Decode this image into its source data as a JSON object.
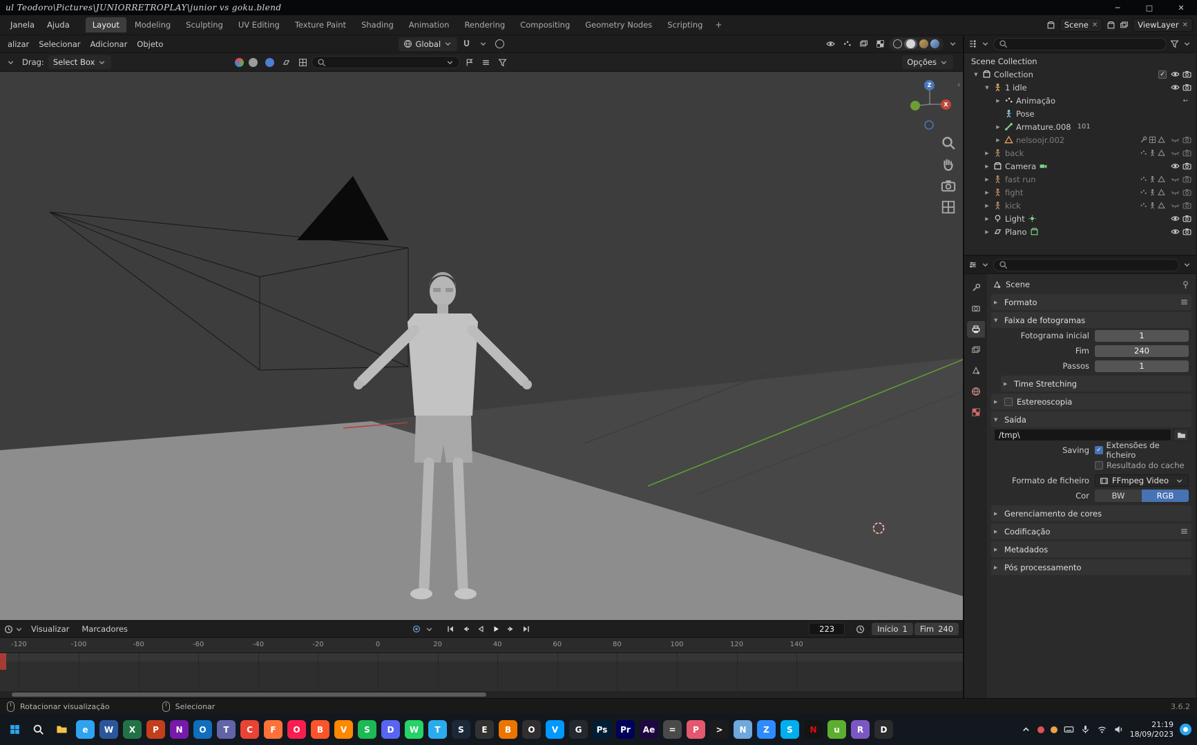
{
  "window": {
    "title": "ul Teodoro\\Pictures\\JUNIORRETROPLAY\\junior vs goku.blend",
    "minimize": "─",
    "maximize": "□",
    "close": "✕"
  },
  "colors": {
    "accent": "#4772b3",
    "axis_green": "#5f9e33",
    "axis_red": "#b34040",
    "viewport_bg": "#3d3d3d",
    "floor": "#8d8d8d"
  },
  "topbar": {
    "menus": [
      "Janela",
      "Ajuda"
    ],
    "workspaces": [
      "Layout",
      "Modeling",
      "Sculpting",
      "UV Editing",
      "Texture Paint",
      "Shading",
      "Animation",
      "Rendering",
      "Compositing",
      "Geometry Nodes",
      "Scripting"
    ],
    "active_workspace": "Layout",
    "add_tab": "+",
    "scene": "Scene",
    "viewlayer": "ViewLayer"
  },
  "viewport": {
    "menus": [
      "alizar",
      "Selecionar",
      "Adicionar",
      "Objeto"
    ],
    "orientation": "Global",
    "drag_label": "Drag:",
    "tool": "Select Box",
    "options": "Opções",
    "gizmo": {
      "z": "Z",
      "x": "X"
    }
  },
  "outliner": {
    "root": "Scene Collection",
    "items": [
      {
        "label": "Collection",
        "depth": 0,
        "arrow": "open",
        "icon": "box",
        "icon_color": "#d8d8d8",
        "checkbox": true,
        "eye": "open",
        "cam": "on"
      },
      {
        "label": "1 idle",
        "depth": 1,
        "arrow": "open",
        "icon": "stickman",
        "icon_color": "#e8a45c",
        "eye": "open",
        "cam": "on"
      },
      {
        "label": "Animação",
        "depth": 2,
        "arrow": "closed",
        "icon": "dots",
        "icon_color": "#d8d8d8",
        "minis": [
          "keys"
        ]
      },
      {
        "label": "Pose",
        "depth": 2,
        "arrow": "none",
        "icon": "stickman",
        "icon_color": "#8fc7e8"
      },
      {
        "label": "Armature.008",
        "depth": 2,
        "arrow": "closed",
        "icon": "bone",
        "icon_color": "#7fd08a",
        "badge": "101"
      },
      {
        "label": "nelsoojr.002",
        "depth": 2,
        "arrow": "closed",
        "icon": "tri",
        "icon_color": "#e8a45c",
        "grayed": true,
        "minis": [
          "wrench",
          "grid",
          "tri"
        ],
        "eye": "closed",
        "cam": "off"
      },
      {
        "label": "back",
        "depth": 1,
        "arrow": "closed",
        "icon": "stickman",
        "icon_color": "#b08a5f",
        "grayed": true,
        "minis": [
          "dots",
          "stickman",
          "tri"
        ],
        "eye": "closed",
        "cam": "off"
      },
      {
        "label": "Camera",
        "depth": 1,
        "arrow": "closed",
        "icon": "camobj",
        "icon_color": "#d8d8d8",
        "extra": "camdata",
        "eye": "open",
        "cam": "on"
      },
      {
        "label": "fast run",
        "depth": 1,
        "arrow": "closed",
        "icon": "stickman",
        "icon_color": "#b08a5f",
        "grayed": true,
        "minis": [
          "dots",
          "stickman",
          "tri"
        ],
        "eye": "closed",
        "cam": "off"
      },
      {
        "label": "fight",
        "depth": 1,
        "arrow": "closed",
        "icon": "stickman",
        "icon_color": "#b08a5f",
        "grayed": true,
        "minis": [
          "dots",
          "stickman",
          "tri"
        ],
        "eye": "closed",
        "cam": "off"
      },
      {
        "label": "kick",
        "depth": 1,
        "arrow": "closed",
        "icon": "stickman",
        "icon_color": "#b08a5f",
        "grayed": true,
        "minis": [
          "dots",
          "stickman",
          "tri"
        ],
        "eye": "closed",
        "cam": "off"
      },
      {
        "label": "Light",
        "depth": 1,
        "arrow": "closed",
        "icon": "bulb",
        "icon_color": "#d8d8d8",
        "extra": "lightdata",
        "eye": "open",
        "cam": "on"
      },
      {
        "label": "Plano",
        "depth": 1,
        "arrow": "closed",
        "icon": "plane",
        "icon_color": "#d8d8d8",
        "extra": "meshdata",
        "eye": "open",
        "cam": "on"
      }
    ]
  },
  "properties": {
    "tabs": [
      {
        "name": "tool"
      },
      {
        "name": "render"
      },
      {
        "name": "output",
        "active": true
      },
      {
        "name": "view-layer"
      },
      {
        "name": "scene"
      },
      {
        "name": "world"
      },
      {
        "name": "texture"
      }
    ],
    "breadcrumb": "Scene",
    "formato": "Formato",
    "frame_range": {
      "title": "Faixa de fotogramas",
      "fields": [
        {
          "label": "Fotograma inicial",
          "value": "1"
        },
        {
          "label": "Fim",
          "value": "240"
        },
        {
          "label": "Passos",
          "value": "1"
        }
      ]
    },
    "time_stretching": "Time Stretching",
    "estereoscopia": "Estereoscopia",
    "saida": {
      "title": "Saída",
      "path": "/tmp\\",
      "saving_label": "Saving",
      "ext_label": "Extensões de ficheiro",
      "cache_label": "Resultado do cache",
      "format_label": "Formato de ficheiro",
      "format_value": "FFmpeg Video",
      "color_label": "Cor",
      "color_options": [
        "BW",
        "RGB"
      ],
      "color_active": 1
    },
    "gerenciamento": "Gerenciamento de cores",
    "codificacao": "Codificação",
    "metadados": "Metadados",
    "pos_processamento": "Pós processamento"
  },
  "timeline": {
    "menus": [
      "Visualizar",
      "Marcadores"
    ],
    "frame": "223",
    "start_label": "Início",
    "start": "1",
    "end_label": "Fim",
    "end": "240",
    "ticks": [
      -120,
      -100,
      -80,
      -60,
      -40,
      -20,
      0,
      20,
      40,
      60,
      80,
      100,
      120,
      140
    ]
  },
  "statusbar": {
    "rotate": "Rotacionar visualização",
    "select": "Selecionar",
    "version": "3.6.2"
  },
  "taskbar": {
    "time": "21:19",
    "date": "18/09/2023",
    "icons": [
      {
        "name": "start",
        "color": "none",
        "svg": "winstart",
        "svg_color": "#2aa7f0"
      },
      {
        "name": "search",
        "color": "none",
        "svg": "magnifier",
        "svg_color": "#e8e8e8"
      },
      {
        "name": "file-explorer",
        "color": "none",
        "svg": "folder",
        "svg_color": "#f7c14b"
      },
      {
        "name": "edge",
        "color": "#2ea3f2",
        "glyph": "e"
      },
      {
        "name": "word",
        "color": "#2b579a",
        "glyph": "W"
      },
      {
        "name": "excel",
        "color": "#217346",
        "glyph": "X"
      },
      {
        "name": "powerpoint",
        "color": "#c43e1c",
        "glyph": "P"
      },
      {
        "name": "onenote",
        "color": "#7719aa",
        "glyph": "N"
      },
      {
        "name": "outlook",
        "color": "#106ebe",
        "glyph": "O"
      },
      {
        "name": "teams",
        "color": "#6264a7",
        "glyph": "T"
      },
      {
        "name": "chrome",
        "color": "#ea4335",
        "glyph": "C"
      },
      {
        "name": "firefox",
        "color": "#ff7139",
        "glyph": "F"
      },
      {
        "name": "opera",
        "color": "#fa1e4e",
        "glyph": "O"
      },
      {
        "name": "brave",
        "color": "#fb542b",
        "glyph": "B"
      },
      {
        "name": "vlc",
        "color": "#ff8800",
        "glyph": "V"
      },
      {
        "name": "spotify",
        "color": "#1db954",
        "glyph": "S"
      },
      {
        "name": "discord",
        "color": "#5865f2",
        "glyph": "D"
      },
      {
        "name": "whatsapp",
        "color": "#25d366",
        "glyph": "W"
      },
      {
        "name": "telegram",
        "color": "#2aabee",
        "glyph": "T"
      },
      {
        "name": "steam",
        "color": "#1b2838",
        "glyph": "S"
      },
      {
        "name": "epic-games",
        "color": "#313131",
        "glyph": "E"
      },
      {
        "name": "blender",
        "color": "#ea7600",
        "glyph": "B"
      },
      {
        "name": "obs",
        "color": "#302e31",
        "glyph": "O"
      },
      {
        "name": "vscode",
        "color": "#0098ff",
        "glyph": "V"
      },
      {
        "name": "github",
        "color": "#24292f",
        "glyph": "G"
      },
      {
        "name": "photoshop",
        "color": "#001e36",
        "glyph": "Ps"
      },
      {
        "name": "premiere",
        "color": "#00005b",
        "glyph": "Pr"
      },
      {
        "name": "after-effects",
        "color": "#1f0740",
        "glyph": "Ae"
      },
      {
        "name": "calculator",
        "color": "#4a4a4a",
        "glyph": "="
      },
      {
        "name": "paint",
        "color": "#e3586e",
        "glyph": "P"
      },
      {
        "name": "terminal",
        "color": "#1b1b1b",
        "glyph": ">"
      },
      {
        "name": "notepad",
        "color": "#6ea8dc",
        "glyph": "N"
      },
      {
        "name": "zoom",
        "color": "#2d8cff",
        "glyph": "Z"
      },
      {
        "name": "skype",
        "color": "#00aff0",
        "glyph": "S"
      },
      {
        "name": "netflix",
        "color": "#141414",
        "glyph": "N",
        "glyph_color": "#e50914"
      },
      {
        "name": "utorrent",
        "color": "#5bae2e",
        "glyph": "u"
      },
      {
        "name": "winrar",
        "color": "#7b57c4",
        "glyph": "R"
      },
      {
        "name": "davinci",
        "color": "#2b2b2b",
        "glyph": "D"
      }
    ]
  }
}
